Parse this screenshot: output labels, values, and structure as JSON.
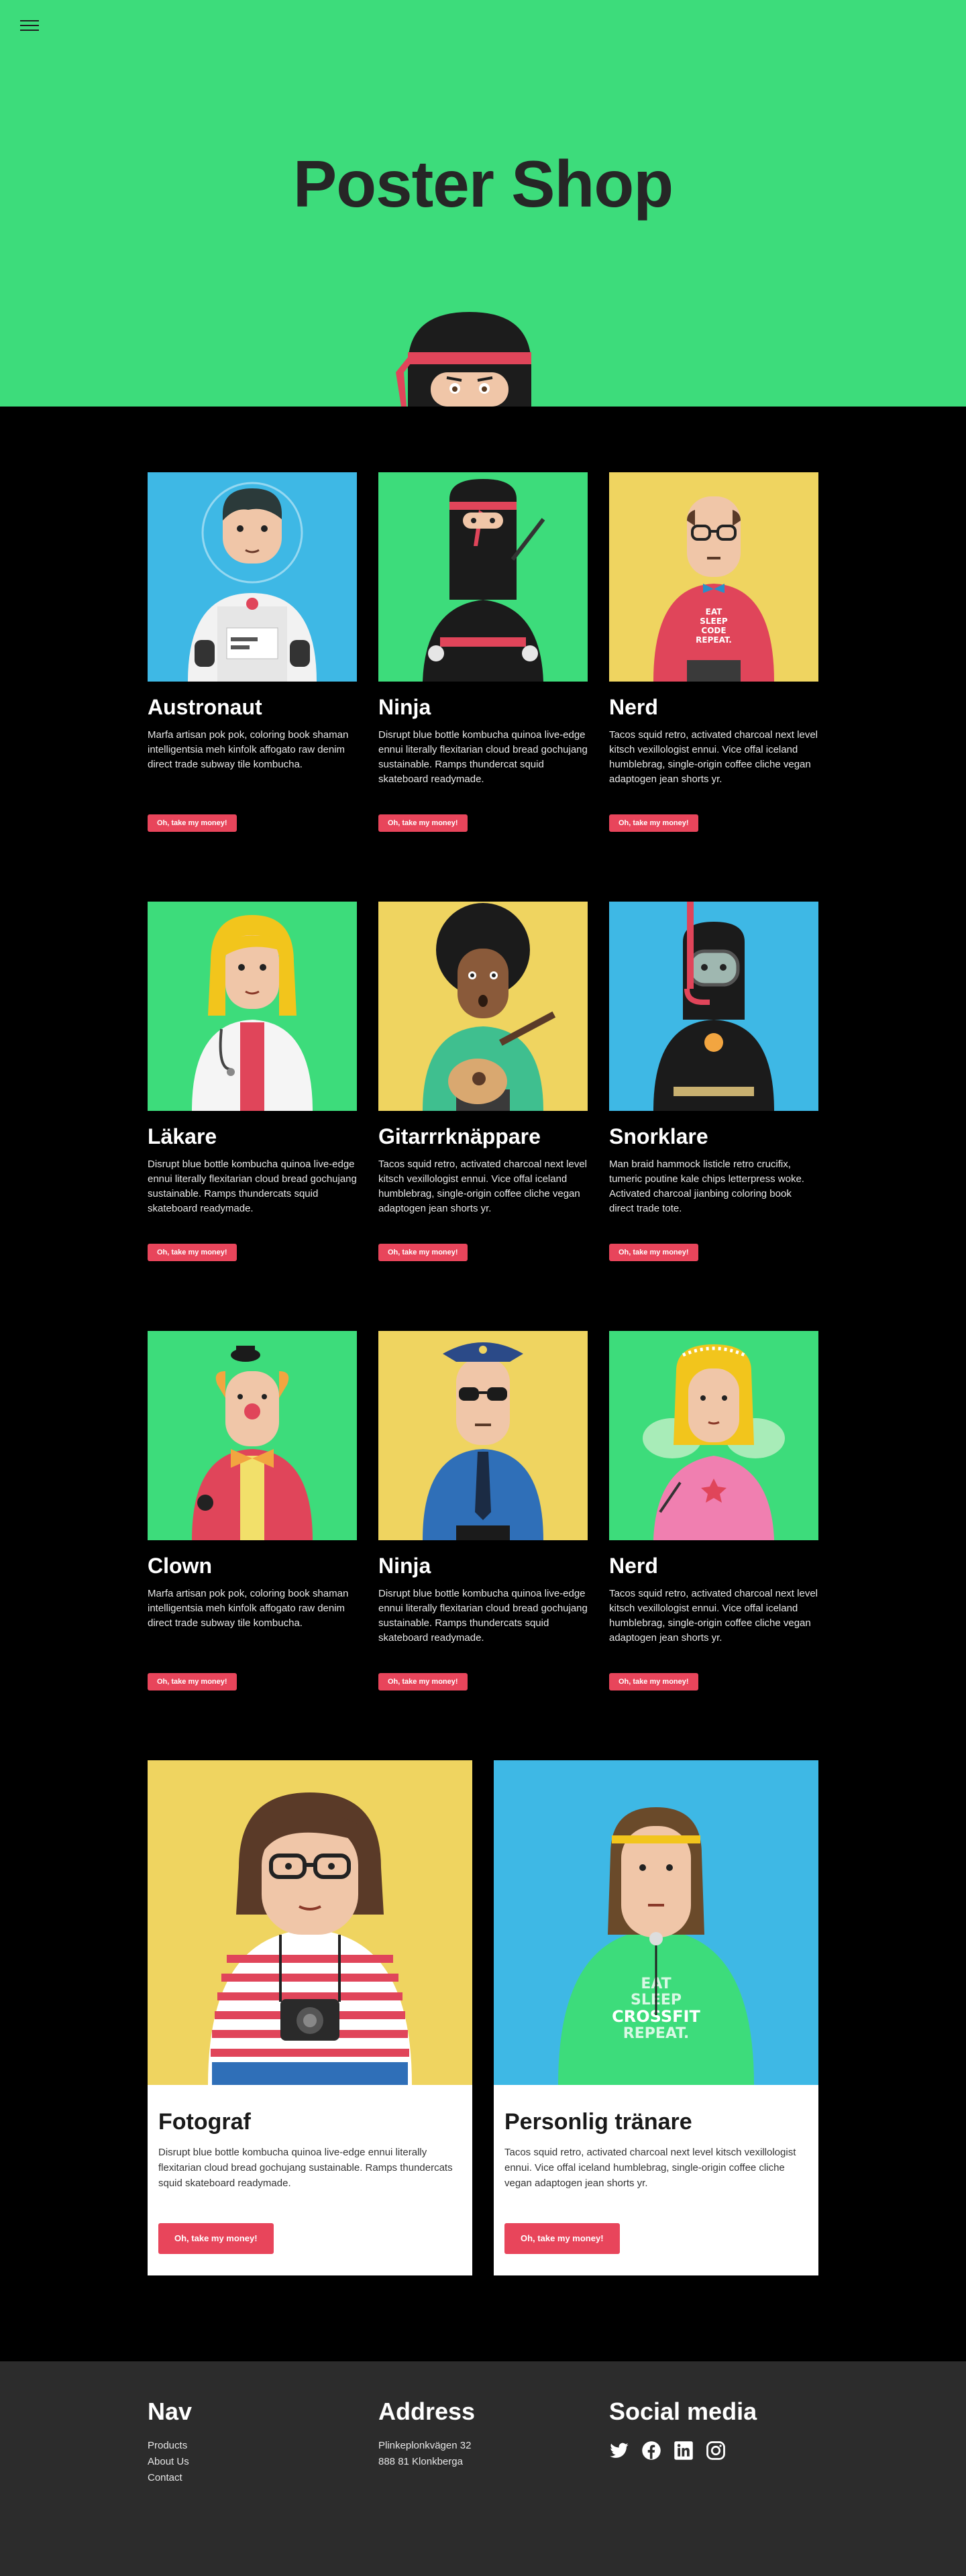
{
  "header": {
    "title": "Poster Shop",
    "menu_icon": "hamburger-menu-icon",
    "background": "#3ddc7b"
  },
  "colors": {
    "green": "#3ddc7b",
    "blue": "#3eb8e5",
    "yellow": "#efd460",
    "accent": "#e8455b",
    "footer": "#2c2c2c"
  },
  "button_label": "Oh, take my money!",
  "products": [
    {
      "name": "Austronaut",
      "bg": "#3eb8e5",
      "description": "Marfa artisan pok pok, coloring book shaman intelligentsia meh kinfolk affogato raw denim direct trade subway tile kombucha."
    },
    {
      "name": "Ninja",
      "bg": "#3ddc7b",
      "description": "Disrupt blue bottle kombucha quinoa live-edge ennui literally flexitarian cloud bread gochujang sustainable. Ramps thundercat squid skateboard readymade."
    },
    {
      "name": "Nerd",
      "bg": "#efd460",
      "description": "Tacos squid retro, activated charcoal next level kitsch vexillologist ennui. Vice offal iceland humblebrag, single-origin coffee cliche vegan adaptogen jean shorts yr."
    },
    {
      "name": "Läkare",
      "bg": "#3ddc7b",
      "description": "Disrupt blue bottle kombucha quinoa live-edge ennui literally flexitarian cloud bread gochujang sustainable. Ramps thundercats squid skateboard readymade."
    },
    {
      "name": "Gitarrrknäppare",
      "bg": "#efd460",
      "description": "Tacos squid retro, activated charcoal next level kitsch vexillologist ennui. Vice offal iceland humblebrag, single-origin coffee cliche vegan adaptogen jean shorts yr."
    },
    {
      "name": "Snorklare",
      "bg": "#3eb8e5",
      "description": "Man braid hammock listicle retro crucifix, tumeric poutine kale chips letterpress woke. Activated charcoal jianbing coloring book direct trade tote."
    },
    {
      "name": "Clown",
      "bg": "#3ddc7b",
      "description": "Marfa artisan pok pok, coloring book shaman intelligentsia meh kinfolk affogato raw denim direct trade subway tile kombucha."
    },
    {
      "name": "Ninja",
      "bg": "#efd460",
      "description": "Disrupt blue bottle kombucha quinoa live-edge ennui literally flexitarian cloud bread gochujang sustainable. Ramps thundercats squid skateboard readymade."
    },
    {
      "name": "Nerd",
      "bg": "#3ddc7b",
      "description": "Tacos squid retro, activated charcoal next level kitsch vexillologist ennui. Vice offal iceland humblebrag, single-origin coffee cliche vegan adaptogen jean shorts yr."
    }
  ],
  "featured": [
    {
      "name": "Fotograf",
      "bg": "#efd460",
      "description": "Disrupt blue bottle kombucha quinoa live-edge ennui literally flexitarian cloud bread gochujang sustainable. Ramps thundercats squid skateboard readymade."
    },
    {
      "name": "Personlig tränare",
      "bg": "#3eb8e5",
      "description": "Tacos squid retro, activated charcoal next level kitsch vexillologist ennui. Vice offal iceland humblebrag, single-origin coffee cliche vegan adaptogen jean shorts yr.",
      "shirt_text": [
        "EAT",
        "SLEEP",
        "CROSSFIT",
        "REPEAT."
      ]
    }
  ],
  "nerd_shirt_text": [
    "EAT",
    "SLEEP",
    "CODE",
    "REPEAT."
  ],
  "footer": {
    "nav": {
      "title": "Nav",
      "links": [
        "Products",
        "About Us",
        "Contact"
      ]
    },
    "address": {
      "title": "Address",
      "street": "Plinkeplonkvägen 32",
      "city": "888 81 Klonkberga"
    },
    "social": {
      "title": "Social media",
      "icons": [
        "twitter-icon",
        "facebook-icon",
        "linkedin-icon",
        "instagram-icon"
      ]
    }
  }
}
